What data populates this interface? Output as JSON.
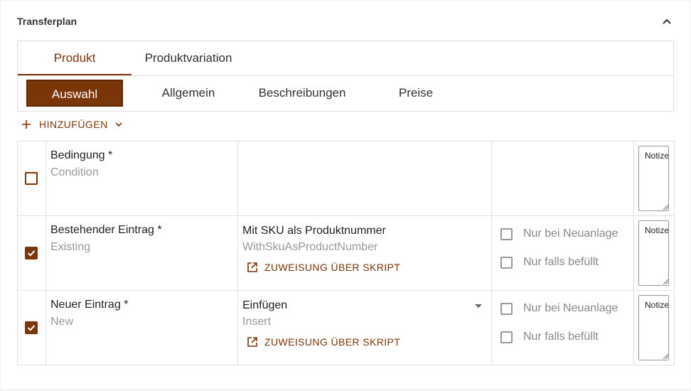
{
  "header": {
    "title": "Transferplan"
  },
  "tabs_primary": [
    {
      "label": "Produkt",
      "active": true
    },
    {
      "label": "Produktvariation",
      "active": false
    }
  ],
  "tabs_secondary": [
    {
      "label": "Auswahl",
      "active": true
    },
    {
      "label": "Allgemein",
      "active": false
    },
    {
      "label": "Beschreibungen",
      "active": false
    },
    {
      "label": "Preise",
      "active": false
    }
  ],
  "add_button": {
    "label": "HINZUFÜGEN"
  },
  "rows": [
    {
      "checked": false,
      "label": "Bedingung *",
      "sublabel": "Condition",
      "value": "",
      "value_sub": "",
      "notes_placeholder": "Notizen"
    },
    {
      "checked": true,
      "label": "Bestehender Eintrag *",
      "sublabel": "Existing",
      "value": "Mit SKU als Produktnummer",
      "value_sub": "WithSkuAsProductNumber",
      "script_link": "ZUWEISUNG ÜBER SKRIPT",
      "options": [
        "Nur bei Neuanlage",
        "Nur falls befüllt"
      ],
      "notes_placeholder": "Notizen"
    },
    {
      "checked": true,
      "label": "Neuer Eintrag *",
      "sublabel": "New",
      "value": "Einfügen",
      "value_sub": "Insert",
      "script_link": "ZUWEISUNG ÜBER SKRIPT",
      "options": [
        "Nur bei Neuanlage",
        "Nur falls befüllt"
      ],
      "notes_placeholder": "Notizen"
    }
  ],
  "colors": {
    "accent": "#7a3508",
    "border": "#e0e0e0",
    "muted": "#999999"
  }
}
